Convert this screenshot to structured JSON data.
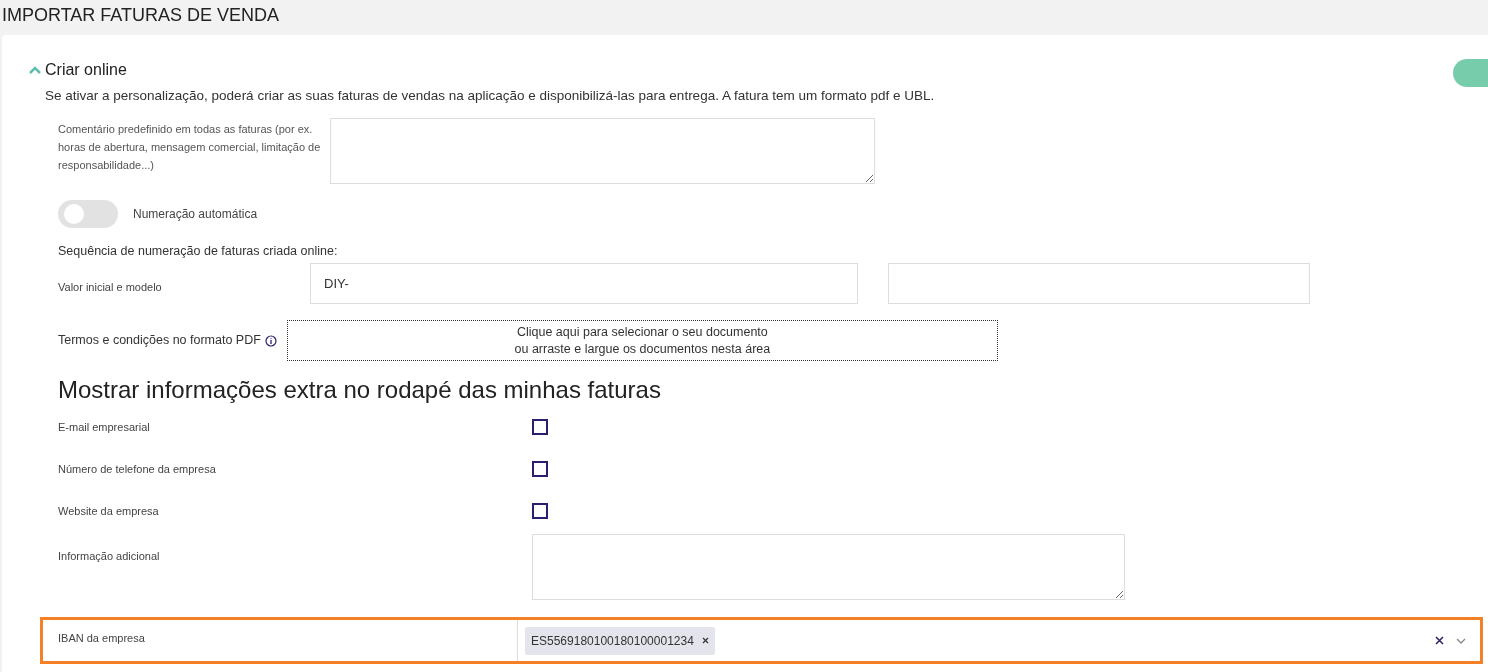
{
  "page": {
    "title": "IMPORTAR FATURAS DE VENDA"
  },
  "section": {
    "title": "Criar online",
    "expanded": true,
    "enabled": true,
    "description": "Se ativar a personalização, poderá criar as suas faturas de vendas na aplicação e disponibilizá-las para entrega. A fatura tem um formato pdf e UBL."
  },
  "comment": {
    "label": "Comentário predefinido em todas as faturas (por ex. horas de abertura, mensagem comercial, limitação de responsabilidade...)"
  },
  "auto_numbering": {
    "label": "Numeração automática",
    "on": false
  },
  "sequence": {
    "title": "Sequência de numeração de faturas criada online:",
    "label": "Valor inicial e modelo",
    "value": "DIY-"
  },
  "terms": {
    "label": "Termos e condições no formato PDF",
    "drop_lines": [
      "Clique aqui para selecionar o seu documento",
      "ou arraste e largue os documentos nesta área"
    ]
  },
  "footer_heading": "Mostrar informações extra no rodapé das minhas faturas",
  "footer_options": [
    {
      "label": "E-mail empresarial",
      "checked": false
    },
    {
      "label": "Número de telefone da empresa",
      "checked": false
    },
    {
      "label": "Website da empresa",
      "checked": false
    }
  ],
  "additional_info": {
    "label": "Informação adicional"
  },
  "iban": {
    "label": "IBAN da empresa",
    "highlighted": true,
    "tags": [
      "ES5569180100180100001234"
    ]
  }
}
